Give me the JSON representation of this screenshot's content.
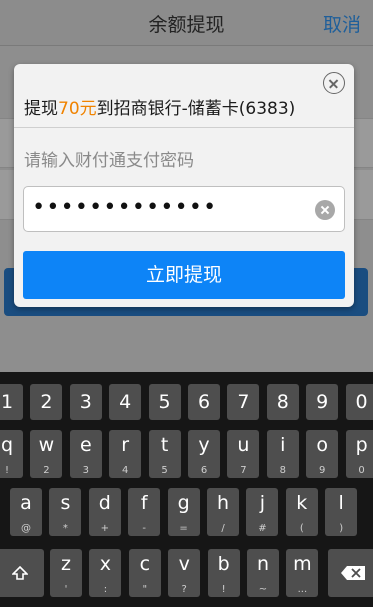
{
  "background": {
    "title": "余额提现",
    "cancel_label": "取消"
  },
  "dialog": {
    "title_prefix": "提现",
    "amount": "70元",
    "title_suffix": "到招商银行-储蓄卡(6383)",
    "close_icon": "close-circle-icon",
    "hint": "请输入财付通支付密码",
    "password_value": "•••••••••••••",
    "clear_icon": "clear-circle-icon",
    "confirm_label": "立即提现"
  },
  "keyboard": {
    "number_row": [
      "1",
      "2",
      "3",
      "4",
      "5",
      "6",
      "7",
      "8",
      "9",
      "0"
    ],
    "row1": [
      {
        "main": "q",
        "sub": "!"
      },
      {
        "main": "w",
        "sub": "2"
      },
      {
        "main": "e",
        "sub": "3"
      },
      {
        "main": "r",
        "sub": "4"
      },
      {
        "main": "t",
        "sub": "5"
      },
      {
        "main": "y",
        "sub": "6"
      },
      {
        "main": "u",
        "sub": "7"
      },
      {
        "main": "i",
        "sub": "8"
      },
      {
        "main": "o",
        "sub": "9"
      },
      {
        "main": "p",
        "sub": "0"
      }
    ],
    "row2": [
      {
        "main": "a",
        "sub": "@"
      },
      {
        "main": "s",
        "sub": "*"
      },
      {
        "main": "d",
        "sub": "+"
      },
      {
        "main": "f",
        "sub": "-"
      },
      {
        "main": "g",
        "sub": "="
      },
      {
        "main": "h",
        "sub": "/"
      },
      {
        "main": "j",
        "sub": "#"
      },
      {
        "main": "k",
        "sub": "("
      },
      {
        "main": "l",
        "sub": ")"
      }
    ],
    "row3": [
      {
        "main": "z",
        "sub": "'"
      },
      {
        "main": "x",
        "sub": ":"
      },
      {
        "main": "c",
        "sub": "\""
      },
      {
        "main": "v",
        "sub": "?"
      },
      {
        "main": "b",
        "sub": "!"
      },
      {
        "main": "n",
        "sub": "~"
      },
      {
        "main": "m",
        "sub": "..."
      }
    ],
    "shift_icon": "shift-icon",
    "backspace_icon": "backspace-icon"
  }
}
